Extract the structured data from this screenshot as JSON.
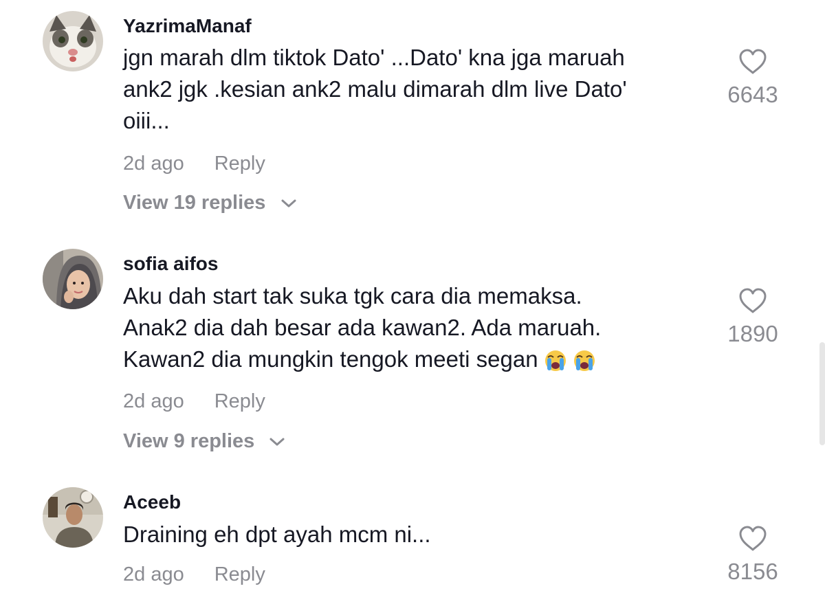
{
  "comments": [
    {
      "username": "YazrimaManaf",
      "lines": [
        "jgn marah dlm tiktok Dato' ...Dato' kna jga maruah",
        "ank2 jgk .kesian ank2 malu dimarah dlm live Dato'",
        "oiii..."
      ],
      "time": "2d ago",
      "reply_label": "Reply",
      "view_replies": "View 19 replies",
      "likes": "6643"
    },
    {
      "username": "sofia aifos",
      "lines": [
        "Aku dah start tak suka tgk cara dia memaksa.",
        "Anak2 dia dah besar ada kawan2. Ada maruah.",
        "Kawan2 dia mungkin tengok meeti segan"
      ],
      "emojis": [
        "loudly-crying-face",
        "loudly-crying-face"
      ],
      "time": "2d ago",
      "reply_label": "Reply",
      "view_replies": "View 9 replies",
      "likes": "1890"
    },
    {
      "username": "Aceeb",
      "lines": [
        "Draining eh dpt ayah mcm ni..."
      ],
      "time": "2d ago",
      "reply_label": "Reply",
      "likes": "8156"
    }
  ],
  "colors": {
    "text": "#161823",
    "muted": "#8a8b91",
    "background": "#ffffff"
  }
}
